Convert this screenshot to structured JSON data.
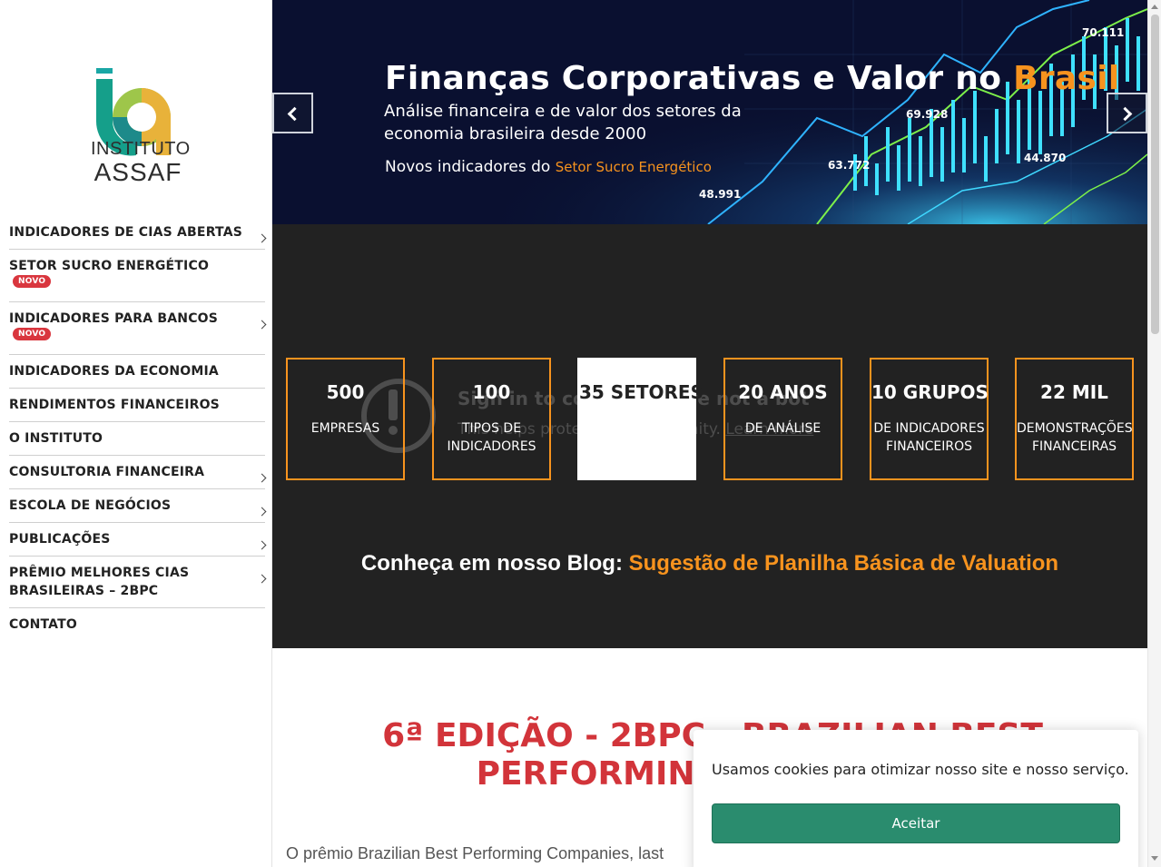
{
  "logo": {
    "line1": "INSTITUTO",
    "line2": "ASSAF"
  },
  "nav": {
    "items": [
      {
        "label": "INDICADORES DE CIAS ABERTAS",
        "badge": "",
        "has_submenu": true
      },
      {
        "label": "SETOR SUCRO ENERGÉTICO",
        "badge": "NOVO",
        "has_submenu": false
      },
      {
        "label": "INDICADORES PARA BANCOS",
        "badge": "NOVO",
        "has_submenu": true
      },
      {
        "label": "INDICADORES DA ECONOMIA",
        "badge": "",
        "has_submenu": false
      },
      {
        "label": "RENDIMENTOS FINANCEIROS",
        "badge": "",
        "has_submenu": false
      },
      {
        "label": "O INSTITUTO",
        "badge": "",
        "has_submenu": false
      },
      {
        "label": "CONSULTORIA FINANCEIRA",
        "badge": "",
        "has_submenu": true
      },
      {
        "label": "ESCOLA DE NEGÓCIOS",
        "badge": "",
        "has_submenu": true
      },
      {
        "label": "PUBLICAÇÕES",
        "badge": "",
        "has_submenu": true
      },
      {
        "label": "PRÊMIO MELHORES CIAS BRASILEIRAS – 2BPC",
        "badge": "",
        "has_submenu": true
      },
      {
        "label": "CONTATO",
        "badge": "",
        "has_submenu": false
      }
    ]
  },
  "hero": {
    "title_main": "Finanças Corporativas e Valor no ",
    "title_highlight": "Brasil",
    "subtitle": "Análise financeira e de valor dos setores da economia brasileira desde 2000",
    "line_prefix": "Novos indicadores do ",
    "line_highlight": "Setor Sucro Energético",
    "chart_labels": [
      "70.111",
      "69.928",
      "63.772",
      "44.870",
      "48.991"
    ],
    "prev_icon": "chevron-left-icon",
    "next_icon": "chevron-right-icon"
  },
  "recaptcha": {
    "title": "Sign in to confirm you're not a bot",
    "body": "This helps protect our community.",
    "link": "Learn more"
  },
  "stats": [
    {
      "number": "500",
      "label": "EMPRESAS"
    },
    {
      "number": "100",
      "label": "TIPOS DE INDICADORES"
    },
    {
      "number": "35 SETORES",
      "label": ""
    },
    {
      "number": "20 ANOS",
      "label": "DE ANÁLISE"
    },
    {
      "number": "10 GRUPOS",
      "label": "DE INDICADORES FINANCEIROS"
    },
    {
      "number": "22 MIL",
      "label": "DEMONSTRAÇÕES FINANCEIRAS"
    }
  ],
  "blog": {
    "prefix": "Conheça em nosso Blog: ",
    "link": "Sugestão de Planilha Básica de Valuation"
  },
  "edition": {
    "title": "6ª EDIÇÃO - 2BPC - BRAZILIAN BEST PERFORMING COMPANIES"
  },
  "intro": {
    "text": "O prêmio Brazilian Best Performing Companies, last"
  },
  "cookie": {
    "message": "Usamos cookies para otimizar nosso site e nosso serviço.",
    "accept": "Aceitar"
  },
  "colors": {
    "accent": "#f7931e",
    "title_red": "#d2343a",
    "badge_red": "#d9363e",
    "accept_green": "#2a8c6e",
    "dark_bg": "#222222",
    "hero_bg": "#0a1030"
  }
}
